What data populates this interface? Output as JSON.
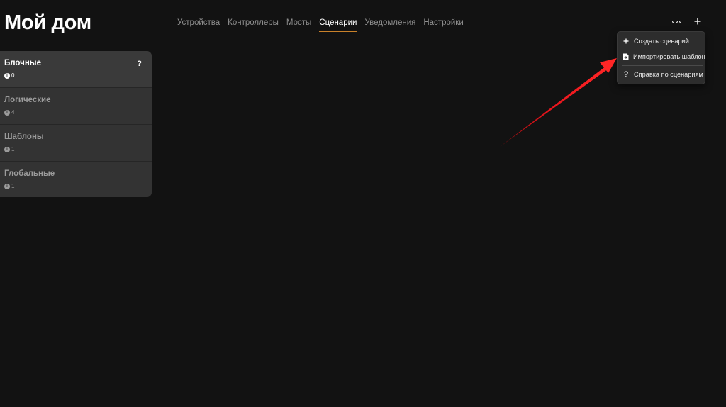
{
  "header": {
    "title": "Мой дом",
    "tabs": [
      {
        "label": "Устройства",
        "active": false
      },
      {
        "label": "Контроллеры",
        "active": false
      },
      {
        "label": "Мосты",
        "active": false
      },
      {
        "label": "Сценарии",
        "active": true
      },
      {
        "label": "Уведомления",
        "active": false
      },
      {
        "label": "Настройки",
        "active": false
      }
    ],
    "more_icon": "more-dots-icon",
    "add_icon": "plus-icon"
  },
  "menu": {
    "items": [
      {
        "label": "Создать сценарий",
        "icon": "plus-icon"
      },
      {
        "label": "Импортировать шаблон",
        "icon": "import-file-icon"
      },
      {
        "label": "Справка по сценариям",
        "icon": "question-icon"
      }
    ]
  },
  "sidebar": {
    "help_label": "?",
    "items": [
      {
        "label": "Блочные",
        "count": "0",
        "active": true
      },
      {
        "label": "Логические",
        "count": "4",
        "active": false
      },
      {
        "label": "Шаблоны",
        "count": "1",
        "active": false
      },
      {
        "label": "Глобальные",
        "count": "1",
        "active": false
      }
    ]
  },
  "colors": {
    "background": "#121212",
    "accent_underline": "#c9812a",
    "annotation_arrow": "#e8141c"
  }
}
